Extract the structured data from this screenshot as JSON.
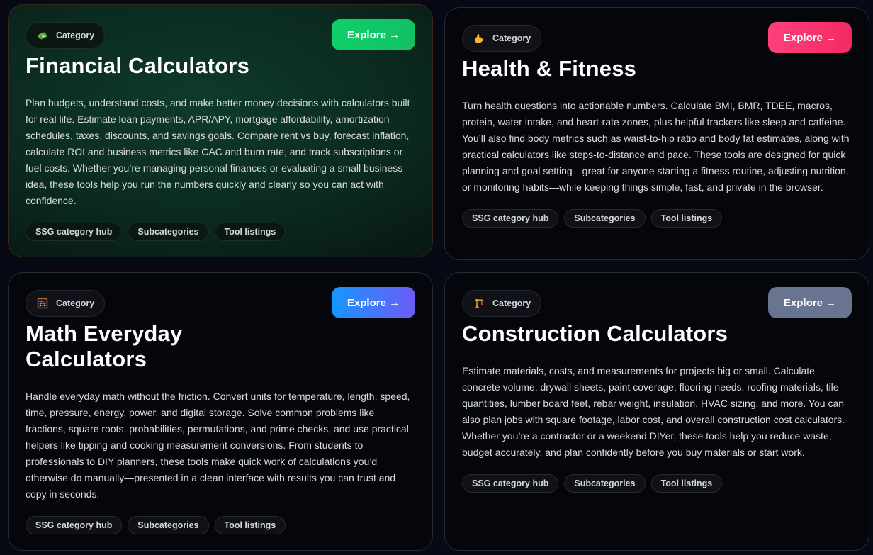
{
  "cards": [
    {
      "category_label": "Category",
      "icon": "money-stack-icon",
      "title": "Financial Calculators",
      "explore_label": "Explore →",
      "accent": "#12c064",
      "description": "Plan budgets, understand costs, and make better money decisions with calculators built for real life. Estimate loan payments, APR/APY, mortgage affordability, amortization schedules, taxes, discounts, and savings goals. Compare rent vs buy, forecast inflation, calculate ROI and business metrics like CAC and burn rate, and track subscriptions or fuel costs. Whether you’re managing personal finances or evaluating a small business idea, these tools help you run the numbers quickly and clearly so you can act with confidence.",
      "tags": [
        "SSG category hub",
        "Subcategories",
        "Tool listings"
      ]
    },
    {
      "category_label": "Category",
      "icon": "flexed-biceps-icon",
      "title": "Health & Fitness",
      "explore_label": "Explore →",
      "accent": "#f22a62",
      "description": "Turn health questions into actionable numbers. Calculate BMI, BMR, TDEE, macros, protein, water intake, and heart-rate zones, plus helpful trackers like sleep and caffeine. You’ll also find body metrics such as waist-to-hip ratio and body fat estimates, along with practical calculators like steps-to-distance and pace. These tools are designed for quick planning and goal setting—great for anyone starting a fitness routine, adjusting nutrition, or monitoring habits—while keeping things simple, fast, and private in the browser.",
      "tags": [
        "SSG category hub",
        "Subcategories",
        "Tool listings"
      ]
    },
    {
      "category_label": "Category",
      "icon": "abacus-icon",
      "title_line1": "Math Everyday",
      "title_line2": "Calculators",
      "explore_label": "Explore →",
      "accent": "#1596ff",
      "description": "Handle everyday math without the friction. Convert units for temperature, length, speed, time, pressure, energy, power, and digital storage. Solve common problems like fractions, square roots, probabilities, permutations, and prime checks, and use practical helpers like tipping and cooking measurement conversions. From students to professionals to DIY planners, these tools make quick work of calculations you’d otherwise do manually—presented in a clean interface with results you can trust and copy in seconds.",
      "tags": [
        "SSG category hub",
        "Subcategories",
        "Tool listings"
      ]
    },
    {
      "category_label": "Category",
      "icon": "construction-crane-icon",
      "title": "Construction Calculators",
      "explore_label": "Explore →",
      "accent": "#687490",
      "description": "Estimate materials, costs, and measurements for projects big or small. Calculate concrete volume, drywall sheets, paint coverage, flooring needs, roofing materials, tile quantities, lumber board feet, rebar weight, insulation, HVAC sizing, and more. You can also plan jobs with square footage, labor cost, and overall construction cost calculators. Whether you’re a contractor or a weekend DIYer, these tools help you reduce waste, budget accurately, and plan confidently before you buy materials or start work.",
      "tags": [
        "SSG category hub",
        "Subcategories",
        "Tool listings"
      ]
    }
  ]
}
